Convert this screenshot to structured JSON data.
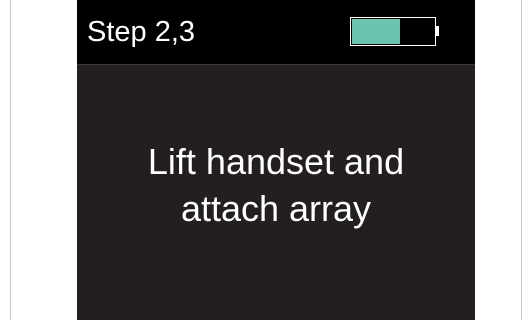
{
  "header": {
    "step_label": "Step 2,3",
    "battery": {
      "level": 0.58,
      "fill_color": "#6cc3b0",
      "icon": "battery-icon"
    }
  },
  "main": {
    "message_lines": [
      "Lift handset and",
      "attach array"
    ]
  },
  "colors": {
    "screen_background": "#231f20",
    "header_background": "#000000",
    "text": "#ffffff",
    "frame_border": "#c8c8c8"
  }
}
